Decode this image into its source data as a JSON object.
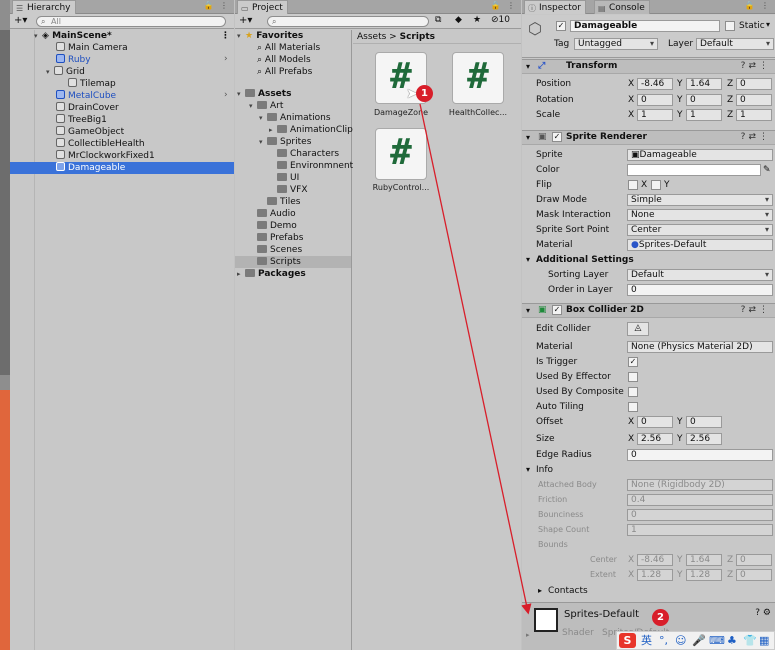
{
  "hierarchy": {
    "tab": "Hierarchy",
    "add_label": "+▾",
    "search_placeholder": "All",
    "scene": "MainScene*",
    "items": [
      "Main Camera",
      "Ruby",
      "Grid",
      "Tilemap",
      "MetalCube",
      "DrainCover",
      "TreeBig1",
      "GameObject",
      "CollectibleHealth",
      "MrClockworkFixed1",
      "Damageable"
    ]
  },
  "project": {
    "tab": "Project",
    "add_label": "+▾",
    "badge_count": "10",
    "favorites": {
      "label": "Favorites",
      "items": [
        "All Materials",
        "All Models",
        "All Prefabs"
      ]
    },
    "tree": [
      "Assets",
      "Art",
      "Animations",
      "AnimationClip",
      "Sprites",
      "Characters",
      "Environmnent",
      "UI",
      "VFX",
      "Tiles",
      "Audio",
      "Demo",
      "Prefabs",
      "Scenes",
      "Scripts",
      "Packages"
    ],
    "breadcrumb": {
      "root": "Assets",
      "sep": ">",
      "current": "Scripts"
    },
    "scripts": [
      "DamageZone",
      "HealthCollec...",
      "RubyControl..."
    ]
  },
  "inspector": {
    "tabs": {
      "inspector": "Inspector",
      "console": "Console"
    },
    "object_name": "Damageable",
    "static_label": "Static",
    "tag_label": "Tag",
    "tag_value": "Untagged",
    "layer_label": "Layer",
    "layer_value": "Default",
    "transform": {
      "title": "Transform",
      "position_label": "Position",
      "position": [
        "-8.46",
        "1.64",
        "0"
      ],
      "rotation_label": "Rotation",
      "rotation": [
        "0",
        "0",
        "0"
      ],
      "scale_label": "Scale",
      "scale": [
        "1",
        "1",
        "1"
      ]
    },
    "sprite_renderer": {
      "title": "Sprite Renderer",
      "sprite_label": "Sprite",
      "sprite_value": "Damageable",
      "color_label": "Color",
      "flip_label": "Flip",
      "flip_x": "X",
      "flip_y": "Y",
      "draw_mode_label": "Draw Mode",
      "draw_mode": "Simple",
      "mask_label": "Mask Interaction",
      "mask": "None",
      "sort_point_label": "Sprite Sort Point",
      "sort_point": "Center",
      "material_label": "Material",
      "material": "Sprites-Default",
      "additional": "Additional Settings",
      "sorting_layer_label": "Sorting Layer",
      "sorting_layer": "Default",
      "order_label": "Order in Layer",
      "order": "0"
    },
    "box_collider": {
      "title": "Box Collider 2D",
      "edit_label": "Edit Collider",
      "material_label": "Material",
      "material": "None (Physics Material 2D)",
      "trigger_label": "Is Trigger",
      "effector_label": "Used By Effector",
      "composite_label": "Used By Composite",
      "tiling_label": "Auto Tiling",
      "offset_label": "Offset",
      "offset": [
        "0",
        "0"
      ],
      "size_label": "Size",
      "size": [
        "2.56",
        "2.56"
      ],
      "edge_label": "Edge Radius",
      "edge": "0",
      "info_label": "Info",
      "attached_label": "Attached Body",
      "attached": "None (Rigidbody 2D)",
      "friction_label": "Friction",
      "friction": "0.4",
      "bounciness_label": "Bounciness",
      "bounciness": "0",
      "shape_label": "Shape Count",
      "shape": "1",
      "bounds_label": "Bounds",
      "center_label": "Center",
      "center": [
        "-8.46",
        "1.64",
        "0"
      ],
      "extent_label": "Extent",
      "extent": [
        "1.28",
        "1.28",
        "0"
      ],
      "contacts_label": "Contacts"
    },
    "material_preview": {
      "name": "Sprites-Default",
      "shader_label": "Shader",
      "shader": "Sprites/Default"
    }
  },
  "annotations": {
    "one": "1",
    "two": "2"
  },
  "ime": {
    "label": "英"
  }
}
